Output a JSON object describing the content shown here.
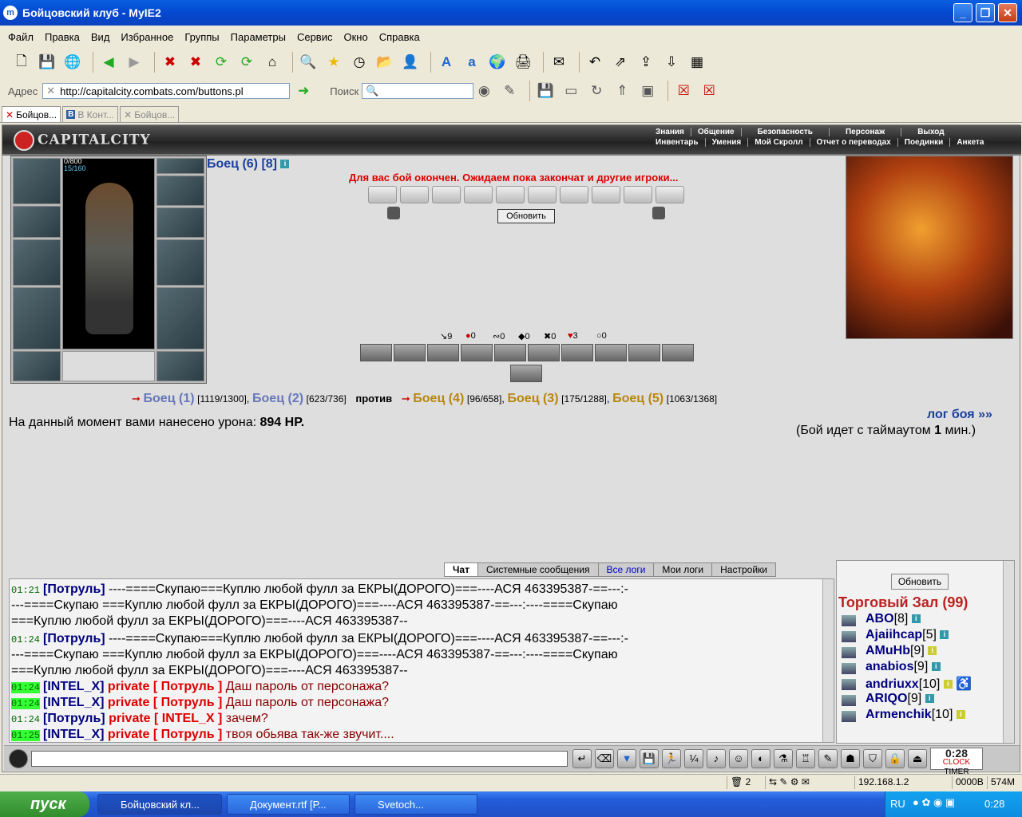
{
  "window": {
    "title": "Бойцовский клуб - MyIE2"
  },
  "menu": [
    "Файл",
    "Правка",
    "Вид",
    "Избранное",
    "Группы",
    "Параметры",
    "Сервис",
    "Окно",
    "Справка"
  ],
  "address": {
    "label": "Адрес",
    "url": "http://capitalcity.combats.com/buttons.pl",
    "search_label": "Поиск"
  },
  "tabs": [
    "Бойцов...",
    "В Конт...",
    "Бойцов..."
  ],
  "game": {
    "logo": "CAPITALCITY",
    "nav_top": [
      "Знания",
      "Общение",
      "Безопасность",
      "Персонаж",
      "Выход"
    ],
    "nav_bottom": [
      "Инвентарь",
      "Умения",
      "Мой Скролл",
      "Отчет о переводах",
      "Поединки",
      "Анкета"
    ],
    "char": {
      "hp": "0/800",
      "mp": "15/160"
    },
    "player_title": "Боец (6) [8]",
    "battle_over": "Для вас бой окончен. Ожидаем пока закончат и другие игроки...",
    "refresh": "Обновить",
    "stats": [
      "9",
      "0",
      "0",
      "0",
      "0",
      "3",
      "0"
    ],
    "team1": [
      {
        "name": "Боец (1)",
        "hp": "[1119/1300]"
      },
      {
        "name": "Боец (2)",
        "hp": "[623/736]"
      }
    ],
    "vs": "против",
    "team2": [
      {
        "name": "Боец (4)",
        "hp": "[96/658]"
      },
      {
        "name": "Боец (3)",
        "hp": "[175/1288]"
      },
      {
        "name": "Боец (5)",
        "hp": "[1063/1368]"
      }
    ],
    "damage_label": "На данный момент вами нанесено урона:",
    "damage_value": "894 HP.",
    "log_link": "лог боя »»",
    "timeout": "(Бой идет с таймаутом",
    "timeout_n": "1",
    "timeout_unit": "мин.)"
  },
  "chat": {
    "tabs": [
      "Чат",
      "Системные сообщения",
      "Все логи",
      "Мои логи",
      "Настройки"
    ],
    "lines": [
      {
        "time": "01:21",
        "nick": "[Потруль]",
        "text": "----====Скупаю===Куплю любой фулл за ЕКРЫ(ДОРОГО)===----АСЯ 463395387-==---:-"
      },
      {
        "time": "",
        "nick": "",
        "text": "---====Скупаю ===Куплю любой фулл за ЕКРЫ(ДОРОГО)===----АСЯ 463395387-==---:----====Скупаю"
      },
      {
        "time": "",
        "nick": "",
        "text": "===Куплю любой фулл за ЕКРЫ(ДОРОГО)===----АСЯ 463395387--"
      },
      {
        "time": "01:24",
        "nick": "[Потруль]",
        "text": "----====Скупаю===Куплю любой фулл за ЕКРЫ(ДОРОГО)===----АСЯ 463395387-==---:-"
      },
      {
        "time": "",
        "nick": "",
        "text": "---====Скупаю ===Куплю любой фулл за ЕКРЫ(ДОРОГО)===----АСЯ 463395387-==---:----====Скупаю"
      },
      {
        "time": "",
        "nick": "",
        "text": "===Куплю любой фулл за ЕКРЫ(ДОРОГО)===----АСЯ 463395387--"
      },
      {
        "time": "01:24",
        "nick": "[INTEL_X]",
        "priv": "private [ Потруль ]",
        "text": "Даш пароль от персонажа?"
      },
      {
        "time": "01:24",
        "nick": "[INTEL_X]",
        "priv": "private [ Потруль ]",
        "text": "Даш пароль от персонажа?"
      },
      {
        "time": "01:24",
        "nick": "[Потруль]",
        "priv": "private [ INTEL_X ]",
        "text": "зачем?"
      },
      {
        "time": "01:25",
        "nick": "[INTEL_X]",
        "priv": "private [ Потруль ]",
        "text": "твоя обьява так-же звучит...."
      }
    ]
  },
  "online": {
    "refresh": "Обновить",
    "room": "Торговый Зал (99)",
    "users": [
      {
        "name": "ABO",
        "level": "[8]"
      },
      {
        "name": "Ajaiihcap",
        "level": "[5]"
      },
      {
        "name": "AMuHb",
        "level": "[9]"
      },
      {
        "name": "anabios",
        "level": "[9]"
      },
      {
        "name": "andriuxx",
        "level": "[10]"
      },
      {
        "name": "ARIQO",
        "level": "[9]"
      },
      {
        "name": "Armenchik",
        "level": "[10]"
      }
    ]
  },
  "clock": {
    "time": "0:28",
    "label": "CLOCK",
    "timer": "TIMER"
  },
  "statusbar": {
    "count": "2",
    "ip": "192.168.1.2",
    "rate": "0000B",
    "mem": "574M"
  },
  "taskbar": {
    "start": "пуск",
    "tasks": [
      "Бойцовский кл...",
      "Документ.rtf [Р...",
      "Svetoch..."
    ],
    "lang": "RU",
    "time": "0:28"
  }
}
